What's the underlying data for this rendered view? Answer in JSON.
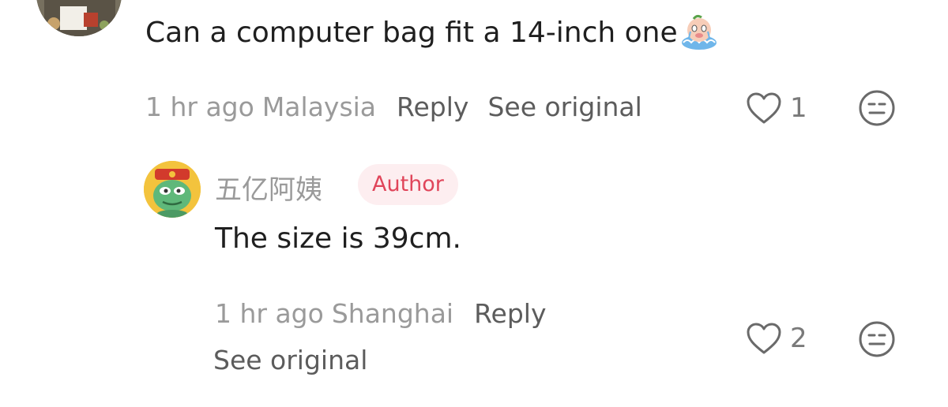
{
  "comment": {
    "text": "Can a computer bag fit a 14-inch one",
    "emoji": "crying-pig-emoji",
    "time": "1 hr ago",
    "location": "Malaysia",
    "reply_label": "Reply",
    "see_original_label": "See original",
    "likes": "1"
  },
  "reply": {
    "author_name": "五亿阿姨",
    "author_badge": "Author",
    "text": "The size is 39cm.",
    "time": "1 hr ago",
    "location": "Shanghai",
    "reply_label": "Reply",
    "see_original_label": "See original",
    "likes": "2"
  },
  "colors": {
    "text": "#1f1f1f",
    "muted": "#9a9a9a",
    "action": "#5c5c5c",
    "badge_bg": "#fdeef0",
    "badge_text": "#e0455a"
  }
}
